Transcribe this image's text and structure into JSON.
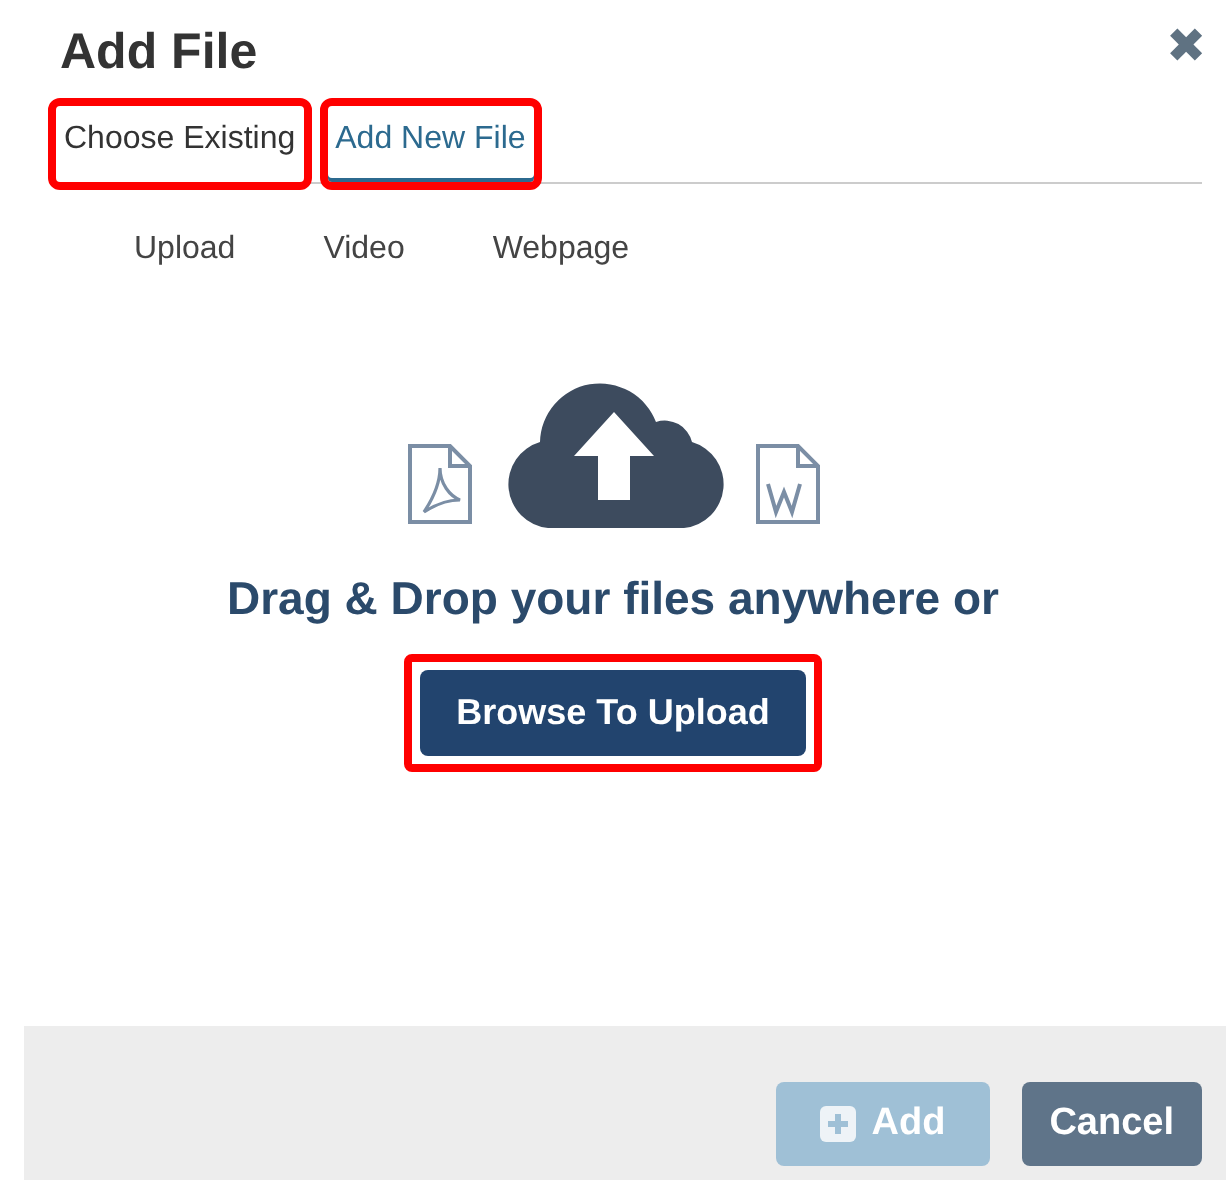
{
  "dialog": {
    "title": "Add File",
    "close": "✖"
  },
  "tabs": [
    {
      "label": "Choose Existing",
      "selected": false,
      "highlighted": true
    },
    {
      "label": "Add New File",
      "selected": true,
      "highlighted": true
    }
  ],
  "sources": [
    {
      "label": "Upload"
    },
    {
      "label": "Video"
    },
    {
      "label": "Webpage"
    }
  ],
  "dropzone": {
    "message": "Drag & Drop your files anywhere or",
    "browse": {
      "label": "Browse To Upload",
      "highlighted": true
    }
  },
  "footer": {
    "buttons": [
      {
        "kind": "add",
        "label": "Add",
        "disabled": true
      },
      {
        "kind": "cancel",
        "label": "Cancel",
        "disabled": false
      }
    ]
  }
}
